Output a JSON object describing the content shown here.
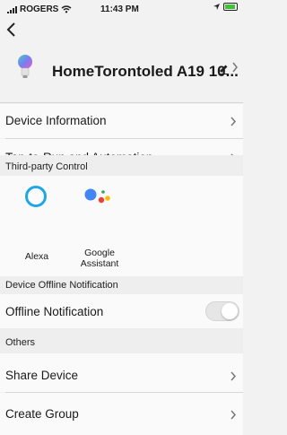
{
  "status_bar": {
    "carrier": "ROGERS",
    "time": "11:43 PM"
  },
  "header": {
    "device_name": "HomeTorontoled A19 10..."
  },
  "menu": {
    "device_information": "Device Information",
    "tap_to_run": "Tap-to-Run and Automation"
  },
  "third_party": {
    "section_title": "Third-party Control",
    "items": [
      {
        "label": "Alexa",
        "icon": "alexa-icon"
      },
      {
        "label": "Google\nAssistant",
        "icon": "google-assistant-icon"
      }
    ]
  },
  "offline": {
    "section_title": "Device Offline Notification",
    "label": "Offline Notification",
    "enabled": false
  },
  "others": {
    "section_title": "Others",
    "share_device": "Share Device",
    "create_group": "Create Group"
  },
  "colors": {
    "alexa": "#1ea7e4",
    "battery": "#43c13a"
  }
}
